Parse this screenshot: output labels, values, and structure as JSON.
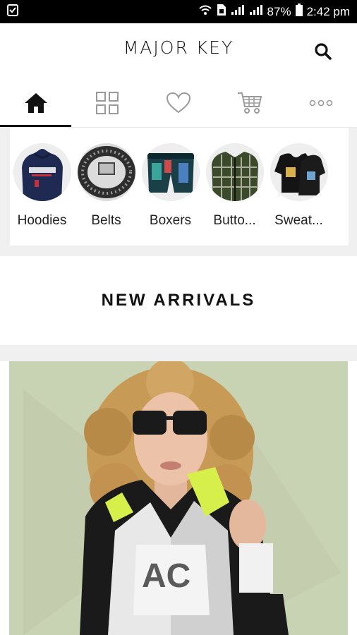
{
  "status_bar": {
    "battery": "87%",
    "time": "2:42 pm"
  },
  "header": {
    "logo": "MAJOR KEY",
    "search_icon": "search-icon"
  },
  "tabs": [
    {
      "icon": "home-icon",
      "active": true
    },
    {
      "icon": "grid-icon",
      "active": false
    },
    {
      "icon": "heart-icon",
      "active": false
    },
    {
      "icon": "cart-icon",
      "active": false
    },
    {
      "icon": "more-icon",
      "active": false
    }
  ],
  "categories": [
    {
      "label": "Hoodies"
    },
    {
      "label": "Belts"
    },
    {
      "label": "Boxers"
    },
    {
      "label": "Butto..."
    },
    {
      "label": "Sweat..."
    }
  ],
  "new_arrivals": {
    "title": "NEW ARRIVALS"
  },
  "colors": {
    "hero_bg": "#c8d3b4",
    "accent": "#111111"
  }
}
